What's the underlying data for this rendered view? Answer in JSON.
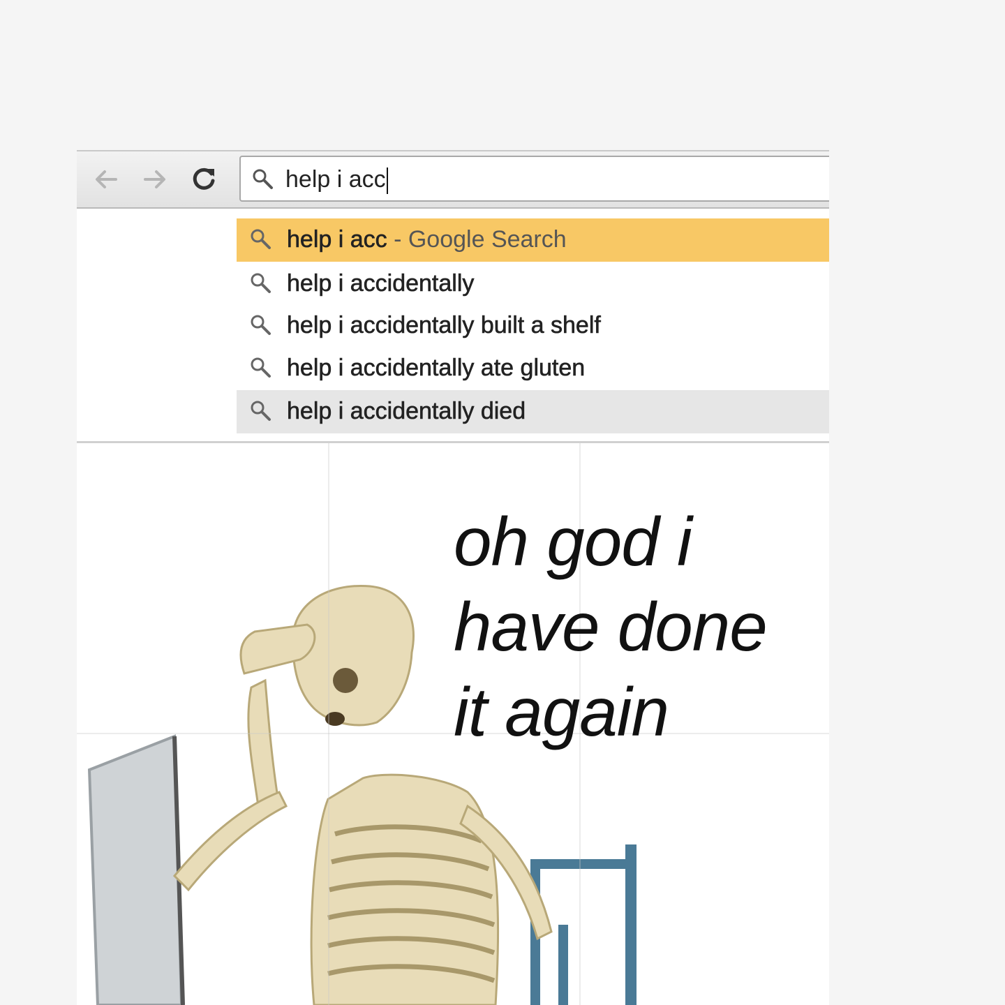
{
  "browser": {
    "omnibox": {
      "query": "help i acc"
    },
    "suggestions": [
      {
        "text": "help i acc",
        "suffix": " - Google Search",
        "highlighted": true
      },
      {
        "text": "help i accidentally",
        "suffix": ""
      },
      {
        "text": "help i accidentally built a shelf",
        "suffix": ""
      },
      {
        "text": "help i accidentally ate gluten",
        "suffix": ""
      },
      {
        "text": "help i accidentally died",
        "suffix": "",
        "hovered": true
      }
    ]
  },
  "caption": {
    "line1": "oh god i",
    "line2": "have done",
    "line3": "it again"
  },
  "colors": {
    "highlight": "#f8c865",
    "hover": "#e6e6e6",
    "bone": "#e8dcb8",
    "chair": "#4a7a96"
  },
  "icons": [
    "back-arrow-icon",
    "forward-arrow-icon",
    "reload-icon",
    "search-icon"
  ]
}
